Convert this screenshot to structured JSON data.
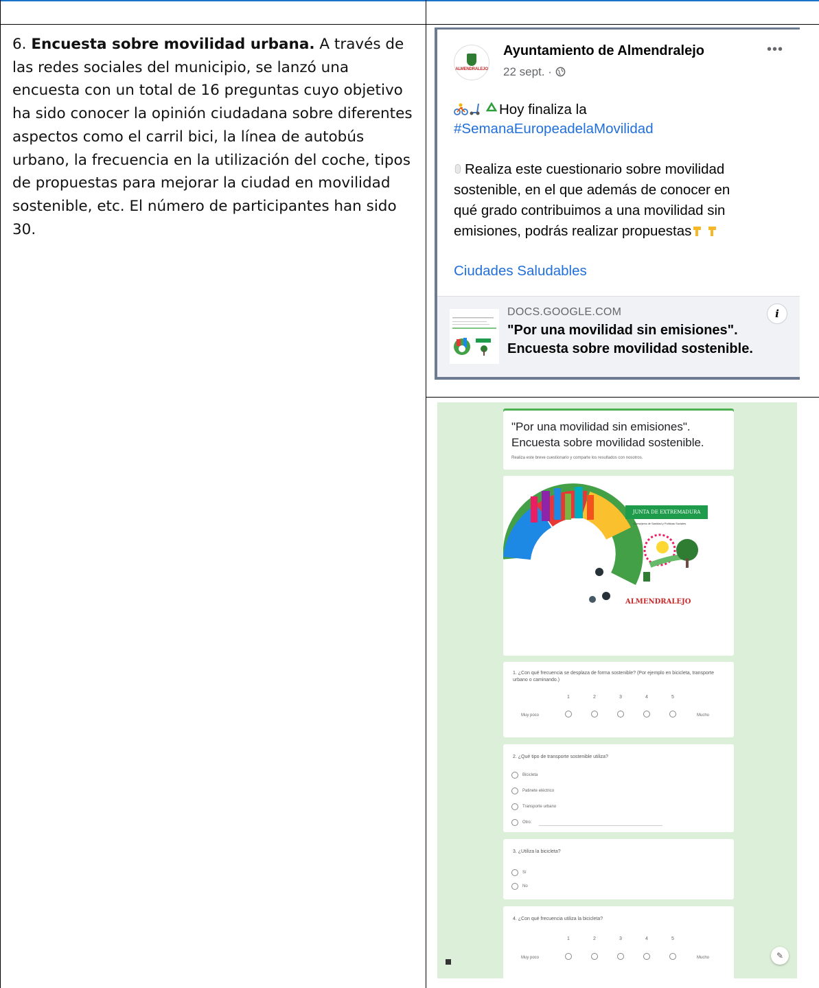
{
  "left_cell": {
    "number": "6. ",
    "heading": "Encuesta sobre movilidad urbana.",
    "body": " A través de las redes sociales del municipio, se lanzó una encuesta con un total de 16 preguntas cuyo objetivo ha sido conocer la opinión ciudadana sobre diferentes aspectos como el carril bici, la línea de autobús urbano, la frecuencia en la utilización del coche, tipos de propuestas para mejorar la ciudad en movilidad sostenible, etc. El número de participantes han sido 30."
  },
  "facebook_post": {
    "page_name": "Ayuntamiento de Almendralejo",
    "avatar_text": "ALMENDRALEJO",
    "meta": "22 sept. · ",
    "more_icon": "more-options-icon",
    "line1_text": "Hoy finaliza la",
    "hashtag": "#SemanaEuropeadelaMovilidad",
    "para_lines": [
      "Realiza este cuestionario sobre movilidad",
      "sostenible, en el que además de conocer en",
      "qué grado contribuimos a una movilidad sin",
      "emisiones, podrás realizar propuestas"
    ],
    "group_link": "Ciudades Saludables",
    "card": {
      "domain": "DOCS.GOOGLE.COM",
      "title_line1": "\"Por una movilidad sin emisiones\".",
      "title_line2": "Encuesta sobre movilidad sostenible.",
      "info_icon": "i"
    },
    "colors": {
      "link": "#216fdb",
      "border": "#6c7a92"
    }
  },
  "google_form": {
    "title_line1": "\"Por una movilidad sin emisiones\".",
    "title_line2": "Encuesta sobre movilidad sostenible.",
    "description": "Realiza este breve cuestionario y comparte los resultados con nosotros.",
    "banner": {
      "junta": "JUNTA DE EXTREMADURA",
      "consejeria": "Consejería de Sanidad y Políticas Sociales",
      "town": "ALMENDRALEJO"
    },
    "q1": {
      "text": "1. ¿Con qué frecuencia se desplaza de forma sostenible? (Por ejemplo en bicicleta, transporte urbano o caminando.)",
      "scale": [
        "1",
        "2",
        "3",
        "4",
        "5"
      ],
      "min_label": "Muy poco",
      "max_label": "Mucho"
    },
    "q2": {
      "text": "2. ¿Qué tipo de transporte sostenible utiliza?",
      "options": [
        "Bicicleta",
        "Patinete eléctrico",
        "Transporte urbano",
        "Otro:"
      ]
    },
    "q3": {
      "text": "3. ¿Utiliza la bicicleta?",
      "options": [
        "Sí",
        "No"
      ]
    },
    "q4": {
      "text": "4. ¿Con qué frecuencia utiliza la bicicleta?",
      "scale": [
        "1",
        "2",
        "3",
        "4",
        "5"
      ],
      "min_label": "Muy poco",
      "max_label": "Mucho"
    },
    "colors": {
      "background": "#dcefd8",
      "accent": "#4caf50"
    }
  }
}
